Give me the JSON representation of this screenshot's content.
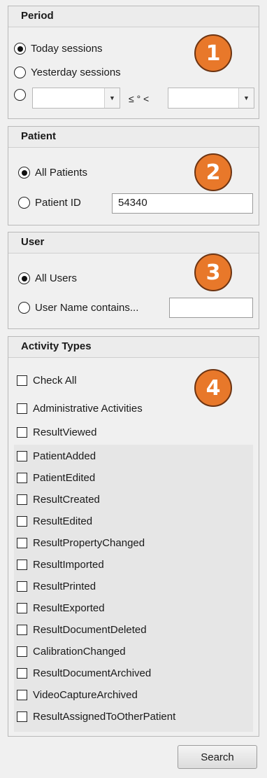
{
  "period": {
    "header": "Period",
    "options": [
      "Today sessions",
      "Yesterday sessions"
    ],
    "range_separator": "≤ ° <",
    "badge": "1"
  },
  "patient": {
    "header": "Patient",
    "all_label": "All Patients",
    "id_label": "Patient ID",
    "id_value": "54340",
    "badge": "2"
  },
  "user": {
    "header": "User",
    "all_label": "All Users",
    "name_label": "User Name contains...",
    "name_value": "",
    "badge": "3"
  },
  "activity": {
    "header": "Activity Types",
    "badge": "4",
    "check_all": "Check All",
    "admin": "Administrative Activities",
    "result_viewed": "ResultViewed",
    "items": [
      "PatientAdded",
      "PatientEdited",
      "ResultCreated",
      "ResultEdited",
      "ResultPropertyChanged",
      "ResultImported",
      "ResultPrinted",
      "ResultExported",
      "ResultDocumentDeleted",
      "CalibrationChanged",
      "ResultDocumentArchived",
      "VideoCaptureArchived",
      "ResultAssignedToOtherPatient"
    ]
  },
  "search_label": "Search"
}
